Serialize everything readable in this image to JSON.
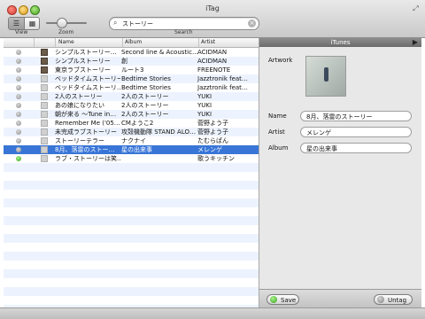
{
  "window": {
    "title": "iTag"
  },
  "toolbar": {
    "view_label": "View",
    "zoom_label": "Zoom",
    "search_label": "Search",
    "search_value": "ストーリー",
    "view_list_glyph": "☰",
    "view_grid_glyph": "▦"
  },
  "table": {
    "columns": [
      "Name",
      "Album",
      "Artist"
    ],
    "rows": [
      {
        "status": "gray",
        "art": "photo",
        "name": "シンプルストーリー…",
        "album": "Second line & Acoustic…",
        "artist": "ACIDMAN"
      },
      {
        "status": "gray",
        "art": "photo",
        "name": "シンプルストーリー",
        "album": "創",
        "artist": "ACIDMAN"
      },
      {
        "status": "gray",
        "art": "photo",
        "name": "東京ラブストーリー",
        "album": "ルート3",
        "artist": "FREENOTE"
      },
      {
        "status": "gray",
        "art": "blank",
        "name": "ベッドタイムストーリー",
        "album": "Bedtime Stories",
        "artist": "Jazztronik feat…"
      },
      {
        "status": "gray",
        "art": "blank",
        "name": "ベッドタイムストーリ…",
        "album": "Bedtime Stories",
        "artist": "Jazztronik feat…"
      },
      {
        "status": "gray",
        "art": "blank",
        "name": "2人のストーリー",
        "album": "2人のストーリー",
        "artist": "YUKI"
      },
      {
        "status": "gray",
        "art": "blank",
        "name": "あの娘になりたい",
        "album": "2人のストーリー",
        "artist": "YUKI"
      },
      {
        "status": "gray",
        "art": "blank",
        "name": "朝が来る 〜Tune in…",
        "album": "2人のストーリー",
        "artist": "YUKI"
      },
      {
        "status": "gray",
        "art": "blank",
        "name": "Remember Me ('05…",
        "album": "CMようこ2",
        "artist": "菅野よう子"
      },
      {
        "status": "gray",
        "art": "blank",
        "name": "未完成ラブストーリー",
        "album": "攻殻機動隊 STAND ALO…",
        "artist": "菅野よう子"
      },
      {
        "status": "gray",
        "art": "blank",
        "name": "ストーリーテラー",
        "album": "ナクナイ",
        "artist": "たむらぱん"
      },
      {
        "status": "gray",
        "art": "blank",
        "name": "8月、落雷のストー…",
        "album": "星の出来事",
        "artist": "メレンゲ",
        "selected": true
      },
      {
        "status": "green",
        "art": "blank",
        "name": "ラブ・ストーリーは笑…",
        "album": "",
        "artist": "歌うキッチン"
      }
    ]
  },
  "inspector": {
    "header": "iTunes",
    "artwork_label": "Artwork",
    "name_label": "Name",
    "name_value": "8月、落雷のストーリー",
    "artist_label": "Artist",
    "artist_value": "メレンゲ",
    "album_label": "Album",
    "album_value": "星の出来事",
    "save_label": "Save",
    "untag_label": "Untag"
  },
  "colors": {
    "selection": "#3875d7",
    "stripe": "#edf3fe",
    "ok_green": "#37a31d"
  }
}
